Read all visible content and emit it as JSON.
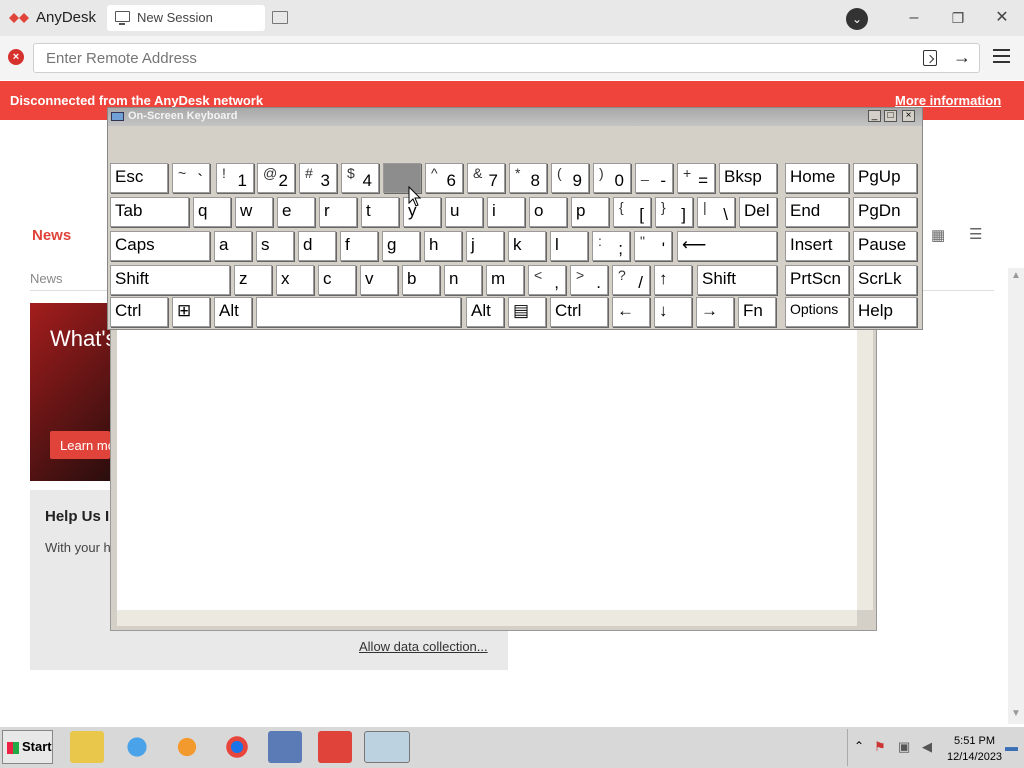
{
  "app": {
    "title": "AnyDesk",
    "tab_label": "New Session"
  },
  "window_controls": {
    "minimize": "–",
    "restore": "❐",
    "close": "✕"
  },
  "account_icon": "⌄",
  "address": {
    "placeholder": "Enter Remote Address"
  },
  "banner": {
    "message": "Disconnected from the AnyDesk network",
    "link": "More information"
  },
  "content": {
    "section_title": "News",
    "subtab": "News",
    "card1_text": "What's new in AnyDesk",
    "card1_button": "Learn more",
    "card2_title": "Help Us Improve",
    "card2_text": "With your help we collect data to improve",
    "allow_link": "Allow data collection..."
  },
  "osk": {
    "title": "On-Screen Keyboard",
    "rows": [
      [
        {
          "m": "Esc"
        },
        {
          "sh": "~",
          "lo": "`"
        },
        {
          "sh": "!",
          "lo": "1"
        },
        {
          "sh": "@",
          "lo": "2"
        },
        {
          "sh": "#",
          "lo": "3"
        },
        {
          "sh": "$",
          "lo": "4"
        },
        {
          "state": "pressed"
        },
        {
          "sh": "^",
          "lo": "6"
        },
        {
          "sh": "&",
          "lo": "7"
        },
        {
          "sh": "*",
          "lo": "8"
        },
        {
          "sh": "(",
          "lo": "9"
        },
        {
          "sh": ")",
          "lo": "0"
        },
        {
          "sh": "_",
          "lo": "-"
        },
        {
          "sh": "+",
          "lo": "="
        },
        {
          "m": "Bksp"
        },
        {
          "m": "Home"
        },
        {
          "m": "PgUp"
        }
      ],
      [
        {
          "m": "Tab"
        },
        {
          "m": "q"
        },
        {
          "m": "w"
        },
        {
          "m": "e"
        },
        {
          "m": "r"
        },
        {
          "m": "t"
        },
        {
          "m": "y"
        },
        {
          "m": "u"
        },
        {
          "m": "i"
        },
        {
          "m": "o"
        },
        {
          "m": "p"
        },
        {
          "sh": "{",
          "lo": "["
        },
        {
          "sh": "}",
          "lo": "]"
        },
        {
          "sh": "|",
          "lo": "\\"
        },
        {
          "m": "Del"
        },
        {
          "m": "End"
        },
        {
          "m": "PgDn"
        }
      ],
      [
        {
          "m": "Caps"
        },
        {
          "m": "a"
        },
        {
          "m": "s"
        },
        {
          "m": "d"
        },
        {
          "m": "f"
        },
        {
          "m": "g"
        },
        {
          "m": "h"
        },
        {
          "m": "j"
        },
        {
          "m": "k"
        },
        {
          "m": "l"
        },
        {
          "sh": ":",
          "lo": ";"
        },
        {
          "sh": "\"",
          "lo": "'"
        },
        {
          "m": "⟵"
        },
        {
          "m": "Insert"
        },
        {
          "m": "Pause"
        }
      ],
      [
        {
          "m": "Shift"
        },
        {
          "m": "z"
        },
        {
          "m": "x"
        },
        {
          "m": "c"
        },
        {
          "m": "v"
        },
        {
          "m": "b"
        },
        {
          "m": "n"
        },
        {
          "m": "m"
        },
        {
          "sh": "<",
          "lo": ","
        },
        {
          "sh": ">",
          "lo": "."
        },
        {
          "sh": "?",
          "lo": "/"
        },
        {
          "m": "↑"
        },
        {
          "m": "Shift"
        },
        {
          "m": "PrtScn"
        },
        {
          "m": "ScrLk"
        }
      ],
      [
        {
          "m": "Ctrl"
        },
        {
          "m": "⊞"
        },
        {
          "m": "Alt"
        },
        {
          "m": ""
        },
        {
          "m": "Alt"
        },
        {
          "m": "▤"
        },
        {
          "m": "Ctrl"
        },
        {
          "m": "←"
        },
        {
          "m": "↓"
        },
        {
          "m": "→"
        },
        {
          "m": "Fn"
        },
        {
          "m": "Options"
        },
        {
          "m": "Help"
        }
      ]
    ]
  },
  "taskbar": {
    "start": "Start",
    "apps": [
      "explorer",
      "internet-explorer",
      "media-player",
      "chrome",
      "remote-desktop",
      "anydesk",
      "on-screen-keyboard"
    ],
    "time": "5:51 PM",
    "date": "12/14/2023"
  },
  "colors": {
    "accent": "#ef443b",
    "brand": "#e0433a",
    "pressed_key": "#8d8d8d"
  }
}
